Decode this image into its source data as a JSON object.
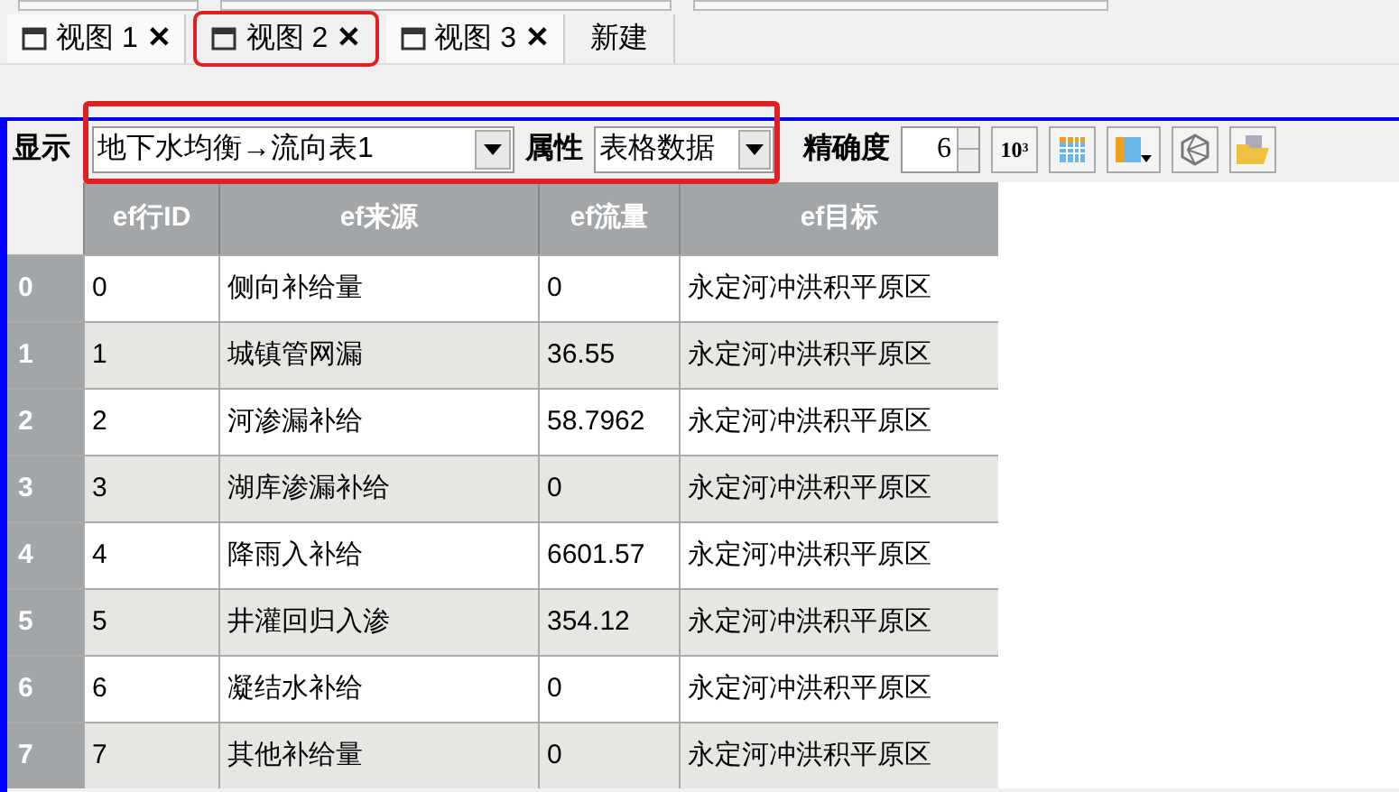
{
  "tabs": [
    {
      "label": "视图 1",
      "close": "✕",
      "selected": false
    },
    {
      "label": "视图 2",
      "close": "✕",
      "selected": true
    },
    {
      "label": "视图 3",
      "close": "✕",
      "selected": false
    }
  ],
  "new_tab": "新建",
  "toolbar": {
    "display_label": "显示",
    "display_value": "地下水均衡→流向表1",
    "attribute_label": "属性",
    "attribute_value": "表格数据",
    "precision_label": "精确度",
    "precision_value": "6",
    "power_button": "10",
    "power_exp": "3"
  },
  "table": {
    "columns": [
      "ef行ID",
      "ef来源",
      "ef流量",
      "ef目标"
    ],
    "rows": [
      {
        "header": "0",
        "cells": [
          "0",
          "侧向补给量",
          "0",
          "永定河冲洪积平原区"
        ]
      },
      {
        "header": "1",
        "cells": [
          "1",
          "城镇管网漏",
          "36.55",
          "永定河冲洪积平原区"
        ]
      },
      {
        "header": "2",
        "cells": [
          "2",
          "河渗漏补给",
          "58.7962",
          "永定河冲洪积平原区"
        ]
      },
      {
        "header": "3",
        "cells": [
          "3",
          "湖库渗漏补给",
          "0",
          "永定河冲洪积平原区"
        ]
      },
      {
        "header": "4",
        "cells": [
          "4",
          "降雨入补给",
          "6601.57",
          "永定河冲洪积平原区"
        ]
      },
      {
        "header": "5",
        "cells": [
          "5",
          "井灌回归入渗",
          "354.12",
          "永定河冲洪积平原区"
        ]
      },
      {
        "header": "6",
        "cells": [
          "6",
          "凝结水补给",
          "0",
          "永定河冲洪积平原区"
        ]
      },
      {
        "header": "7",
        "cells": [
          "7",
          "其他补给量",
          "0",
          "永定河冲洪积平原区"
        ]
      }
    ]
  }
}
